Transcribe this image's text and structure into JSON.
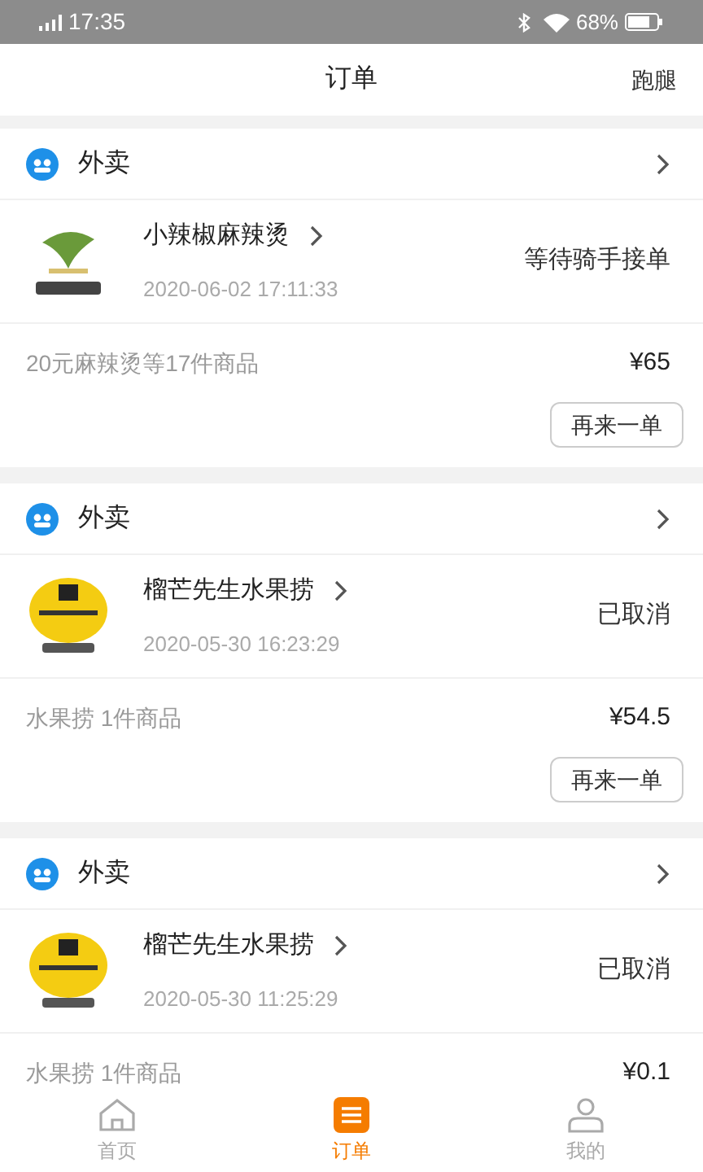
{
  "status_bar": {
    "time": "17:35",
    "battery": "68%"
  },
  "header": {
    "title": "订单",
    "action": "跑腿"
  },
  "orders": [
    {
      "category": "外卖",
      "store": "小辣椒麻辣烫",
      "kind": "leaf",
      "time": "2020-06-02 17:11:33",
      "status": "等待骑手接单",
      "summary": "20元麻辣烫等17件商品",
      "price": "¥65",
      "button": "再来一单"
    },
    {
      "category": "外卖",
      "store": "榴芒先生水果捞",
      "kind": "round",
      "time": "2020-05-30 16:23:29",
      "status": "已取消",
      "summary": "水果捞 1件商品",
      "price": "¥54.5",
      "button": "再来一单"
    },
    {
      "category": "外卖",
      "store": "榴芒先生水果捞",
      "kind": "round",
      "time": "2020-05-30 11:25:29",
      "status": "已取消",
      "summary": "水果捞 1件商品",
      "price": "¥0.1"
    }
  ],
  "tabs": [
    {
      "label": "首页",
      "kind": "home",
      "selected": false
    },
    {
      "label": "订单",
      "kind": "list",
      "selected": true
    },
    {
      "label": "我的",
      "kind": "user",
      "selected": false
    }
  ]
}
